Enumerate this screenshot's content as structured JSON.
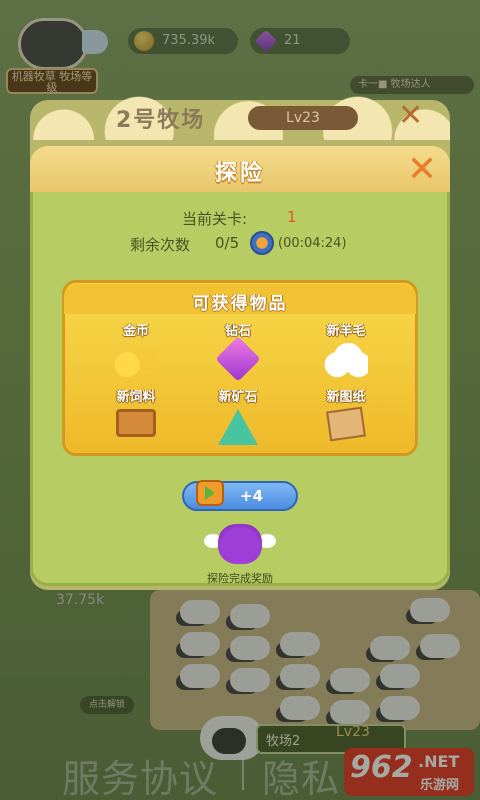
{
  "hud": {
    "coins": "735.39k",
    "gems": "21",
    "ranch_level_tag": "机器牧草\n牧场等级",
    "top_right": "卡一■  牧场达人"
  },
  "back_panel": {
    "title": "2号牧场",
    "level": "Lv23"
  },
  "dialog": {
    "title": "探险",
    "current_level_label": "当前关卡:",
    "current_level_value": "1",
    "remaining_label": "剩余次数",
    "remaining_value": "0/5",
    "remaining_timer": "(00:04:24)",
    "rewards_title": "可获得物品",
    "rewards": [
      {
        "name": "金币",
        "icon": "coins-icon"
      },
      {
        "name": "钻石",
        "icon": "diamond-icon"
      },
      {
        "name": "新羊毛",
        "icon": "wool-icon"
      },
      {
        "name": "新饲料",
        "icon": "feed-icon"
      },
      {
        "name": "新矿石",
        "icon": "ore-icon"
      },
      {
        "name": "新图纸",
        "icon": "blueprint-icon"
      }
    ],
    "video_button_label": "+4",
    "completion_reward_label": "探险完成奖励"
  },
  "background": {
    "count_text": "37.75k",
    "unlock_text": "点击解锁",
    "bottom_ranch": "牧场2",
    "bottom_lv": "Lv23",
    "footer_agreement": "服务协议",
    "footer_privacy": "隐私",
    "watermark_num": "962",
    "watermark_net": ".NET",
    "watermark_cn": "乐游网"
  },
  "colors": {
    "dialog_bg": "#b7cc62",
    "header_bg": "#e8c66c",
    "reward_panel": "#eeb92a",
    "accent_orange": "#e67e2a",
    "video_button": "#4d8ce0"
  }
}
